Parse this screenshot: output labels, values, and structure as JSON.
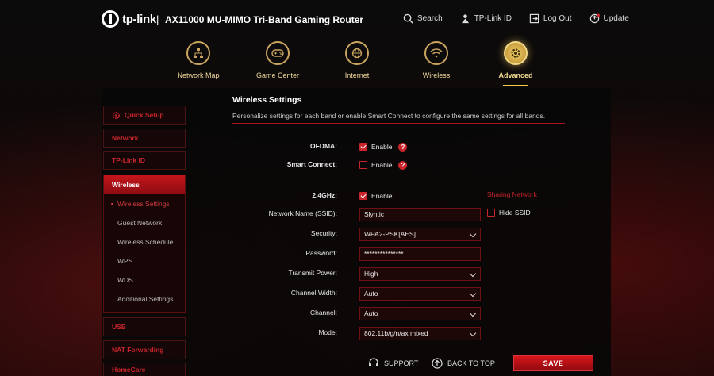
{
  "brand": {
    "logo_text": "tp-link",
    "separator": "|",
    "model": "AX11000 MU-MIMO Tri-Band Gaming Router"
  },
  "top_links": [
    {
      "label": "Search",
      "icon": "search-icon"
    },
    {
      "label": "TP-Link ID",
      "icon": "user-id-icon"
    },
    {
      "label": "Log Out",
      "icon": "logout-icon"
    },
    {
      "label": "Update",
      "icon": "update-icon"
    }
  ],
  "main_nav": [
    {
      "label": "Network Map",
      "icon": "network-map-icon",
      "active": false
    },
    {
      "label": "Game Center",
      "icon": "gamepad-icon",
      "active": false
    },
    {
      "label": "Internet",
      "icon": "globe-icon",
      "active": false
    },
    {
      "label": "Wireless",
      "icon": "wifi-icon",
      "active": false
    },
    {
      "label": "Advanced",
      "icon": "gear-icon",
      "active": true
    }
  ],
  "sidebar": {
    "quick_setup": "Quick Setup",
    "network": "Network",
    "tplink_id": "TP-Link ID",
    "wireless": {
      "label": "Wireless",
      "items": [
        "Wireless Settings",
        "Guest Network",
        "Wireless Schedule",
        "WPS",
        "WDS",
        "Additional Settings"
      ]
    },
    "usb": "USB",
    "nat_forwarding": "NAT Forwarding",
    "homecare": "HomeCare"
  },
  "content": {
    "title": "Wireless Settings",
    "description": "Personalize settings for each band or enable Smart Connect to configure the same settings for all bands.",
    "ofdma": {
      "label": "OFDMA:",
      "option": "Enable",
      "checked": true
    },
    "smart_connect": {
      "label": "Smart Connect:",
      "option": "Enable",
      "checked": false
    },
    "band_24": {
      "label": "2.4GHz:",
      "option": "Enable",
      "checked": true
    },
    "sharing_network": "Sharing Network",
    "ssid": {
      "label": "Network Name (SSID):",
      "value": "Slyntic"
    },
    "hide_ssid": {
      "label": "Hide SSID",
      "checked": false
    },
    "security": {
      "label": "Security:",
      "value": "WPA2-PSK[AES]"
    },
    "password": {
      "label": "Password:",
      "value": "***************"
    },
    "transmit_power": {
      "label": "Transmit Power:",
      "value": "High"
    },
    "channel_width": {
      "label": "Channel Width:",
      "value": "Auto"
    },
    "channel": {
      "label": "Channel:",
      "value": "Auto"
    },
    "mode": {
      "label": "Mode:",
      "value": "802.11b/g/n/ax mixed"
    },
    "help_glyph": "?"
  },
  "footer": {
    "support": "SUPPORT",
    "back_to_top": "BACK TO TOP",
    "save": "SAVE"
  },
  "colors": {
    "accent_red": "#c8252b",
    "gold": "#f0d99a"
  }
}
